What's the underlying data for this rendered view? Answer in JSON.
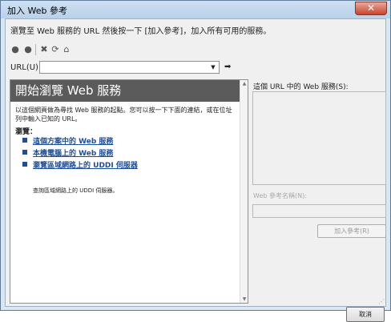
{
  "window": {
    "title": "加入 Web 參考",
    "close_icon": "close-icon",
    "close_glyph": "✕"
  },
  "description": "瀏覽至 Web 服務的 URL 然後按一下 [加入參考]，加入所有可用的服務。",
  "toolbar": {
    "icons": [
      "back-icon",
      "forward-icon",
      "stop-icon",
      "refresh-icon",
      "home-icon"
    ],
    "glyphs": {
      "back": "●",
      "forward": "●",
      "stop": "✖",
      "refresh": "⟳",
      "home": "⌂"
    }
  },
  "url": {
    "label": "URL(U):",
    "value": "",
    "dropdown_glyph": "▼",
    "go_glyph": "➡"
  },
  "browser": {
    "heading": "開始瀏覽 Web 服務",
    "intro": "以這個網頁做為尋找 Web 服務的起點。您可以按一下下面的連結，或在位址列中輸入已知的 URL。",
    "browse_label": "瀏覽：",
    "links": [
      {
        "text": "這個方案中的 Web 服務"
      },
      {
        "text": "本機電腦上的 Web 服務"
      },
      {
        "text": "瀏覽區域網路上的 UDDI 伺服器"
      }
    ],
    "uddi_description": "查詢區域網路上的 UDDI 伺服器。",
    "scroll_up": "▲",
    "scroll_down": "▼"
  },
  "services": {
    "label": "這個 URL 中的 Web 服務(S):",
    "items": []
  },
  "reference_name": {
    "label": "Web 參考名稱(N):",
    "value": ""
  },
  "buttons": {
    "add_reference": "加入參考(R)",
    "cancel": "取消"
  },
  "colors": {
    "heading_background": "#5b5b5b",
    "link": "#1f4e96",
    "disabled_text": "#9a9a9a"
  },
  "resize_grip": "⋰"
}
